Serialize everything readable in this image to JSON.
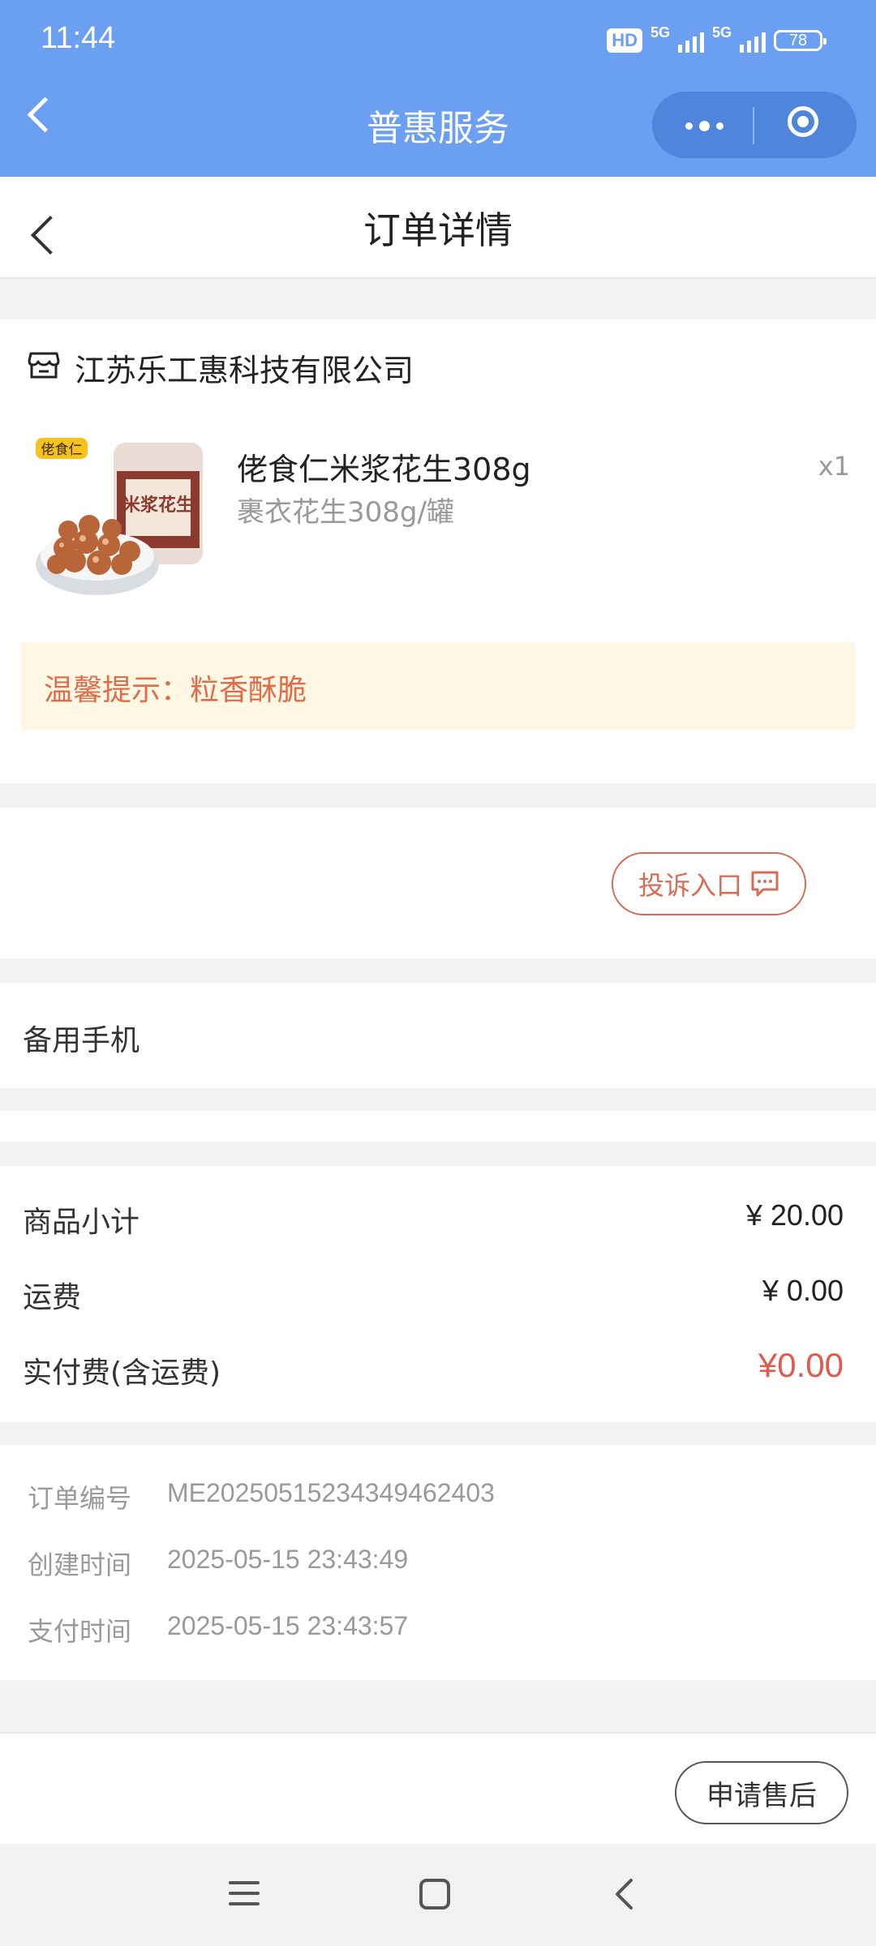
{
  "status_bar": {
    "time": "11:44",
    "hd": "HD",
    "net1": "5G",
    "net2": "5G",
    "battery": "78"
  },
  "miniprogram": {
    "title": "普惠服务",
    "back_icon": "back-chevron-icon",
    "more_icon": "more-dots-icon",
    "close_icon": "target-circle-icon"
  },
  "page": {
    "title": "订单详情"
  },
  "shop": {
    "name": "江苏乐工惠科技有限公司",
    "icon": "store-icon"
  },
  "product": {
    "name": "佬食仁米浆花生308g",
    "spec": "裹衣花生308g/罐",
    "quantity": "x1",
    "image_brand_text": "佬食仁",
    "image_label_text": "米浆花生"
  },
  "tip": {
    "text": "温馨提示：粒香酥脆"
  },
  "complaint": {
    "label": "投诉入口",
    "icon": "message-icon"
  },
  "backup_phone": {
    "label": "备用手机"
  },
  "costs": {
    "subtotal_label": "商品小计",
    "subtotal_value": "¥ 20.00",
    "shipping_label": "运费",
    "shipping_value": "¥ 0.00",
    "paid_label": "实付费(含运费)",
    "paid_value": "¥0.00",
    "paid_color": "#e05a4e"
  },
  "order_info": {
    "order_no_label": "订单编号",
    "order_no": "ME2025051523434946240З",
    "created_label": "创建时间",
    "created": "2025-05-15 23:43:49",
    "paid_label": "支付时间",
    "paid": "2025-05-15 23:43:57"
  },
  "footer": {
    "aftersale_label": "申请售后"
  },
  "colors": {
    "topbar": "#6a9ff2",
    "capsule": "#4f86dc",
    "accent_red": "#e05a4e",
    "tip_bg": "#fdf7e3"
  }
}
